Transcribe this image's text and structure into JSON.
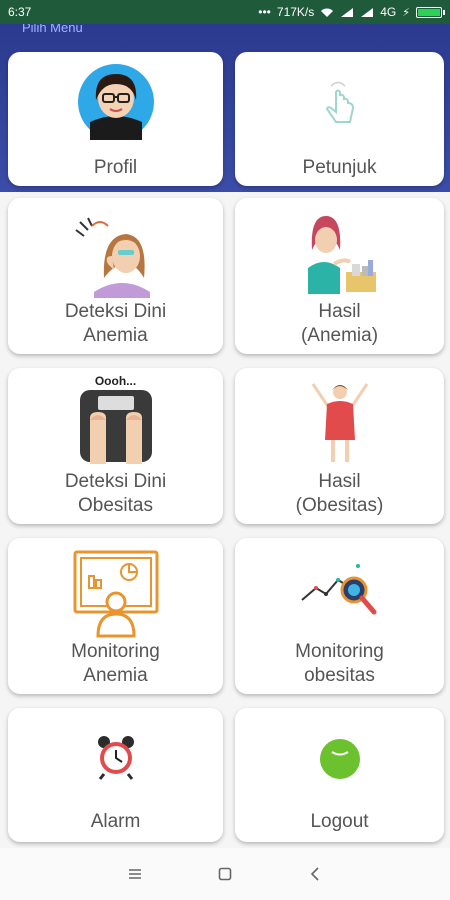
{
  "status_bar": {
    "time": "6:37",
    "speed": "717K/s",
    "network": "4G"
  },
  "header": {
    "title": "Pilih Menu"
  },
  "menu": [
    {
      "id": "profil",
      "label_line1": "Profil",
      "label_line2": ""
    },
    {
      "id": "petunjuk",
      "label_line1": "Petunjuk",
      "label_line2": ""
    },
    {
      "id": "deteksi-anemia",
      "label_line1": "Deteksi Dini",
      "label_line2": "Anemia"
    },
    {
      "id": "hasil-anemia",
      "label_line1": "Hasil",
      "label_line2": "(Anemia)"
    },
    {
      "id": "deteksi-obesitas",
      "label_line1": "Deteksi Dini",
      "label_line2": "Obesitas",
      "scale_text": "Oooh..."
    },
    {
      "id": "hasil-obesitas",
      "label_line1": "Hasil",
      "label_line2": "(Obesitas)"
    },
    {
      "id": "monitoring-anemia",
      "label_line1": "Monitoring",
      "label_line2": "Anemia"
    },
    {
      "id": "monitoring-obesitas",
      "label_line1": "Monitoring",
      "label_line2": "obesitas"
    },
    {
      "id": "alarm",
      "label_line1": "Alarm",
      "label_line2": ""
    },
    {
      "id": "logout",
      "label_line1": "Logout",
      "label_line2": ""
    }
  ],
  "colors": {
    "header_blue": "#2b3a8e",
    "accent_orange": "#e8952f",
    "logout_green": "#6cc12e"
  },
  "icons": {
    "nav_menu": "menu-lines-icon",
    "nav_home": "square-home-icon",
    "nav_back": "back-chevron-icon"
  }
}
